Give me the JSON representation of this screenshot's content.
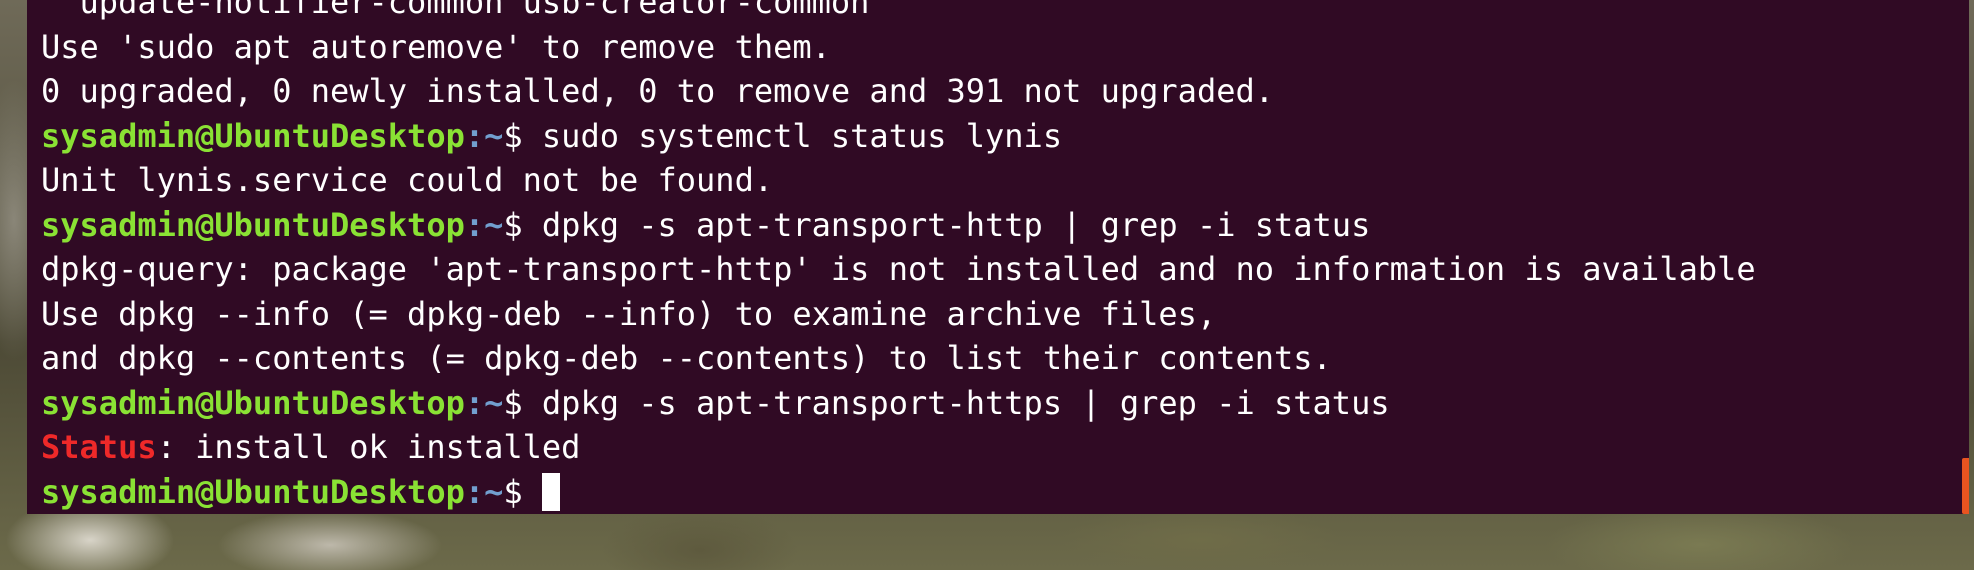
{
  "terminal": {
    "lines": [
      {
        "type": "output",
        "text": "  update-notifier-common usb-creator-common"
      },
      {
        "type": "output",
        "text": "Use 'sudo apt autoremove' to remove them."
      },
      {
        "type": "output",
        "text": "0 upgraded, 0 newly installed, 0 to remove and 391 not upgraded."
      },
      {
        "type": "prompt",
        "user": "sysadmin@UbuntuDesktop",
        "path": ":~",
        "symbol": "$ ",
        "command": "sudo systemctl status lynis"
      },
      {
        "type": "output",
        "text": "Unit lynis.service could not be found."
      },
      {
        "type": "prompt",
        "user": "sysadmin@UbuntuDesktop",
        "path": ":~",
        "symbol": "$ ",
        "command": "dpkg -s apt-transport-http | grep -i status"
      },
      {
        "type": "output",
        "text": "dpkg-query: package 'apt-transport-http' is not installed and no information is available"
      },
      {
        "type": "output",
        "text": "Use dpkg --info (= dpkg-deb --info) to examine archive files,"
      },
      {
        "type": "output",
        "text": "and dpkg --contents (= dpkg-deb --contents) to list their contents."
      },
      {
        "type": "prompt",
        "user": "sysadmin@UbuntuDesktop",
        "path": ":~",
        "symbol": "$ ",
        "command": "dpkg -s apt-transport-https | grep -i status"
      },
      {
        "type": "status",
        "keyword": "Status",
        "text": ": install ok installed"
      },
      {
        "type": "prompt",
        "user": "sysadmin@UbuntuDesktop",
        "path": ":~",
        "symbol": "$ ",
        "command": "",
        "cursor": true
      }
    ]
  },
  "colors": {
    "terminal_background": "#300a24",
    "output_text": "#ffffff",
    "prompt_user": "#8ae234",
    "prompt_path": "#729fcf",
    "grep_match": "#ef2929",
    "scrollbar": "#e95420"
  }
}
